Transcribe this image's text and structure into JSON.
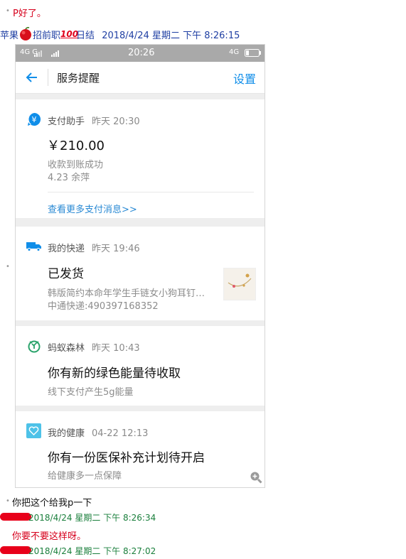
{
  "chat": {
    "msg1": "P好了。",
    "sender1_prefix": "苹果",
    "sender1_suffix": "招前职",
    "sender1_suffix2": "日结",
    "time1": "2018/4/24 星期二 下午 8:26:15",
    "msg2": "你把这个给我p一下",
    "time2": "2018/4/24 星期二 下午 8:26:34",
    "msg3": "你要不要这样呀。",
    "time3": "2018/4/24 星期二 下午 8:27:02",
    "badge_100": "100"
  },
  "phone": {
    "status": {
      "left": "4G  G",
      "time": "20:26",
      "right": "4G"
    },
    "nav": {
      "title": "服务提醒",
      "settings": "设置"
    },
    "cards": [
      {
        "source": "支付助手",
        "time": "昨天 20:30",
        "amount": "￥210.00",
        "line1": "收款到账成功",
        "line2": "4.23   余萍",
        "link": "查看更多支付消息>>"
      },
      {
        "source": "我的快递",
        "time": "昨天 19:46",
        "title": "已发货",
        "line1": "韩版简约本命年学生手链女小狗耳钉…",
        "line2": "中通快递:490397168352"
      },
      {
        "source": "蚂蚁森林",
        "time": "昨天 10:43",
        "title": "你有新的绿色能量待收取",
        "line1": "线下支付产生5g能量"
      },
      {
        "source": "我的健康",
        "time": "04-22 12:13",
        "title": "你有一份医保补充计划待开启",
        "line1": "给健康多一点保障"
      }
    ]
  },
  "colors": {
    "alipay_blue": "#108ee9",
    "link_blue": "#2a8ad4",
    "forest_green": "#2aa36b",
    "red_text": "#d6001c"
  }
}
